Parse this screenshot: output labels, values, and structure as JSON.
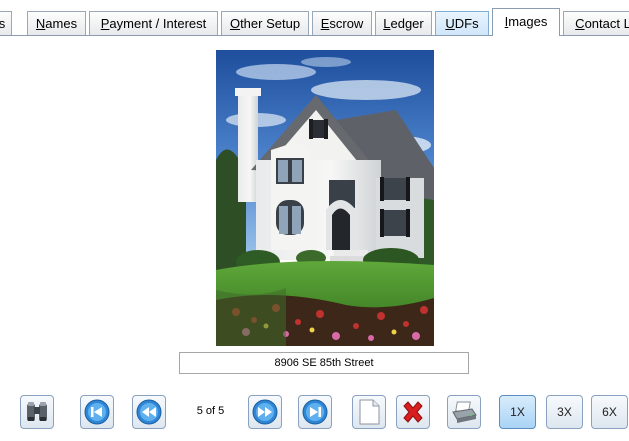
{
  "tabs": [
    {
      "label": "s",
      "underline": ""
    },
    {
      "label": "Names",
      "underline": "N"
    },
    {
      "label": "Payment / Interest",
      "underline": "P"
    },
    {
      "label": "Other Setup",
      "underline": "O"
    },
    {
      "label": "Escrow",
      "underline": "E"
    },
    {
      "label": "Ledger",
      "underline": "L"
    },
    {
      "label": "UDFs",
      "underline": "U"
    },
    {
      "label": "Images",
      "underline": "I"
    },
    {
      "label": "Contact L",
      "underline": "C"
    }
  ],
  "active_tab": "Images",
  "image": {
    "caption": "8906 SE 85th Street"
  },
  "navigation": {
    "counter": "5 of 5"
  },
  "zoom": {
    "options": [
      "1X",
      "3X",
      "6X"
    ],
    "selected": "1X"
  },
  "toolbar": {
    "icons": [
      "binoculars-icon",
      "first-icon",
      "previous-icon",
      "next-icon",
      "last-icon",
      "new-page-icon",
      "delete-icon",
      "print-icon"
    ]
  },
  "colors": {
    "accent": "#3a8fd8",
    "delete": "#d81e1e",
    "selected_zoom_bg": "#bfe0f8"
  }
}
